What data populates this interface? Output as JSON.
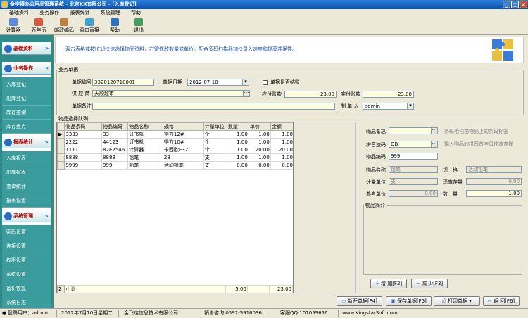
{
  "title": "金宇得办公用品管理系统 - 北京XX有限公司 - [入库登记]",
  "menu": [
    "基础资料",
    "业务操作",
    "报表统计",
    "系统管理",
    "帮助"
  ],
  "toolbar": [
    {
      "label": "计算器",
      "icon": "calculator-icon",
      "color": "#5a8ad8"
    },
    {
      "label": "万年历",
      "icon": "calendar-icon",
      "color": "#d85a40"
    },
    {
      "label": "邮政编码",
      "icon": "postcode-icon",
      "color": "#c08040"
    },
    {
      "label": "窗口直接",
      "icon": "window-icon",
      "color": "#40a0d0"
    },
    {
      "label": "帮助",
      "icon": "help-icon",
      "color": "#3070c0"
    },
    {
      "label": "退出",
      "icon": "exit-icon",
      "color": "#40a060"
    }
  ],
  "sidebar": {
    "basic": "基础资料",
    "ops": {
      "title": "业务操作",
      "items": [
        "入库登记",
        "出库登记",
        "库存查询",
        "库存盘点"
      ]
    },
    "reports": {
      "title": "报表统计",
      "items": [
        "入库报表",
        "出库报表",
        "查询统计",
        "报表设置"
      ]
    },
    "system": {
      "title": "系统管理",
      "items": [
        "密码设置",
        "连接设置",
        "权限设置",
        "系统设置",
        "备份恢复",
        "系统日志"
      ]
    }
  },
  "hint": "双击表格或按[F1]快速选择物品资料，右键修改数量或单价。配合多码扫描器加快录入速度和提高准确性。",
  "business": {
    "legend": "业务单据",
    "no_label": "单据编号",
    "no_value": "3320120710001",
    "date_label": "单据日期",
    "date_value": "2012-07-10",
    "settled_label": "单据是否结账",
    "supplier_label": "供 应 商",
    "supplier_value": "天顺超市",
    "payable_label": "应付账款",
    "payable_value": "23.00",
    "paid_label": "实付账款",
    "paid_value": "23.00",
    "note_label": "单据备注",
    "note_value": "",
    "maker_label": "制 单 人",
    "maker_value": "admin"
  },
  "grid": {
    "legend": "物品选择队列",
    "columns": [
      "物品条码",
      "物品编码",
      "物品名称",
      "规格",
      "计量单位",
      "数量",
      "单价",
      "金额"
    ],
    "rows": [
      [
        "3333",
        "33",
        "订书机",
        "得力12#",
        "个",
        "1.00",
        "1.00",
        "1.00"
      ],
      [
        "2222",
        "44123",
        "订书机",
        "得力10#",
        "个",
        "1.00",
        "1.00",
        "1.00"
      ],
      [
        "1111",
        "87E2546",
        "计算器",
        "卡西欧E32",
        "个",
        "1.00",
        "20.00",
        "20.00"
      ],
      [
        "8888",
        "8888",
        "铅笔",
        "28",
        "支",
        "1.00",
        "1.00",
        "1.00"
      ],
      [
        "9999",
        "999",
        "铅笔",
        "活动铅笔",
        "支",
        "0.00",
        "0.00",
        "0.00"
      ]
    ],
    "subtotal_label": "小计",
    "subtotal_qty": "5.00",
    "subtotal_amount": "23.00"
  },
  "item": {
    "barcode_label": "物品条码",
    "barcode_value": "",
    "barcode_hint": "条码枪扫描物品上的条码标签",
    "pinyin_label": "拼音速码",
    "pinyin_value": "QB",
    "pinyin_hint": "输入物品的拼音首字母快速查找",
    "code_label": "物品编码",
    "code_value": "999",
    "name_label": "物品名称",
    "name_value": "铅笔",
    "spec_label": "规　格",
    "spec_value": "活动铅笔",
    "unit_label": "计量单位",
    "unit_value": "支",
    "stock_label": "现库存量",
    "stock_value": "0.00",
    "ref_price_label": "参考单价",
    "ref_price_value": "0.00",
    "qty_label": "数　量",
    "qty_value": "1.00",
    "desc_label": "物品简介"
  },
  "buttons": {
    "add": "增 加[F2]",
    "reduce": "减 少[F3]",
    "new": "新开单据[F4]",
    "save": "保存单据[F5]",
    "print": "打印单据",
    "back": "返 回[F6]"
  },
  "status": {
    "user": "登录用户：admin",
    "date": "2012年7月10日星期二",
    "company": "金飞达信息技术有限公司",
    "sales": "销售咨询:0592-5916036",
    "qq": "客服QQ:107059656",
    "site": "www.KingstarSoft.com"
  }
}
